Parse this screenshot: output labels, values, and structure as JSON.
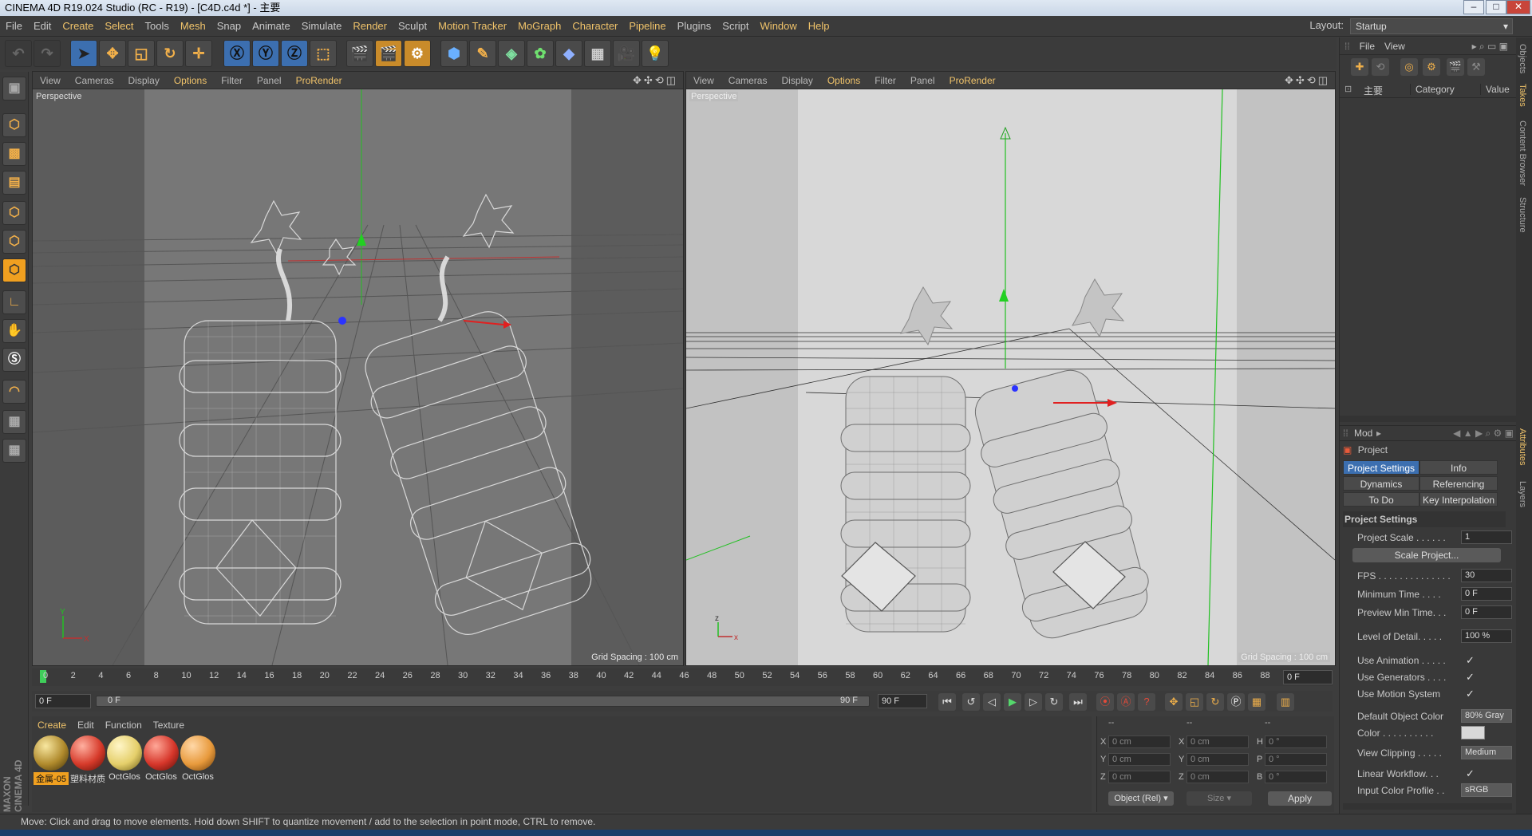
{
  "window": {
    "title": "CINEMA 4D R19.024 Studio (RC - R19) - [C4D.c4d *] - 主要"
  },
  "menu": [
    "File",
    "Edit",
    "Create",
    "Select",
    "Tools",
    "Mesh",
    "Snap",
    "Animate",
    "Simulate",
    "Render",
    "Sculpt",
    "Motion Tracker",
    "MoGraph",
    "Character",
    "Pipeline",
    "Plugins",
    "Script",
    "Window",
    "Help"
  ],
  "layout": {
    "label": "Layout:",
    "value": "Startup"
  },
  "viewport_left": {
    "menu": [
      "View",
      "Cameras",
      "Display",
      "Options",
      "Filter",
      "Panel",
      "ProRender"
    ],
    "label": "Perspective",
    "grid": "Grid Spacing : 100 cm"
  },
  "viewport_right": {
    "menu": [
      "View",
      "Cameras",
      "Display",
      "Options",
      "Filter",
      "Panel",
      "ProRender"
    ],
    "label": "Perspective",
    "grid": "Grid Spacing : 100 cm"
  },
  "timeline": {
    "ticks": [
      "0",
      "2",
      "4",
      "6",
      "8",
      "10",
      "12",
      "14",
      "16",
      "18",
      "20",
      "22",
      "24",
      "26",
      "28",
      "30",
      "32",
      "34",
      "36",
      "38",
      "40",
      "42",
      "44",
      "46",
      "48",
      "50",
      "52",
      "54",
      "56",
      "58",
      "60",
      "62",
      "64",
      "66",
      "68",
      "70",
      "72",
      "74",
      "76",
      "78",
      "80",
      "82",
      "84",
      "86",
      "88",
      "90"
    ],
    "frame_field": "0 F"
  },
  "transport": {
    "start": "0 F",
    "slider_left": "0 F",
    "slider_right": "90 F",
    "end": "90 F"
  },
  "materials": {
    "menu": [
      "Create",
      "Edit",
      "Function",
      "Texture"
    ],
    "items": [
      {
        "name": "金属-05",
        "color": "#b08a2c"
      },
      {
        "name": "塑料材质",
        "color": "#d63a2a"
      },
      {
        "name": "OctGlos",
        "color": "#e5cf6a"
      },
      {
        "name": "OctGlos",
        "color": "#d6362a"
      },
      {
        "name": "OctGlos",
        "color": "#e89a3c"
      }
    ]
  },
  "coords": {
    "headers": [
      "--",
      "--",
      "--"
    ],
    "rows": [
      {
        "a": "X",
        "av": "0 cm",
        "b": "X",
        "bv": "0 cm",
        "c": "H",
        "cv": "0 °"
      },
      {
        "a": "Y",
        "av": "0 cm",
        "b": "Y",
        "bv": "0 cm",
        "c": "P",
        "cv": "0 °"
      },
      {
        "a": "Z",
        "av": "0 cm",
        "b": "Z",
        "bv": "0 cm",
        "c": "B",
        "cv": "0 °"
      }
    ],
    "mode": "Object (Rel)",
    "size": "Size",
    "apply": "Apply"
  },
  "objects": {
    "menu": [
      "File",
      "View"
    ],
    "root": "主要",
    "cols": [
      "Category",
      "Value"
    ]
  },
  "attributes": {
    "mode": "Mod",
    "project": "Project",
    "tabs": [
      "Project Settings",
      "Info",
      "Dynamics",
      "Referencing",
      "To Do",
      "Key Interpolation"
    ],
    "section": "Project Settings",
    "fields": [
      {
        "label": "Project Scale . . . . . .",
        "value": "1"
      },
      {
        "label": "FPS . . . . . . . . . . . . . .",
        "value": "30"
      },
      {
        "label": "Minimum Time . . . .",
        "value": "0 F"
      },
      {
        "label": "Preview Min Time. . .",
        "value": "0 F"
      },
      {
        "label": "Level of Detail. . . . .",
        "value": "100 %"
      }
    ],
    "scale_button": "Scale Project...",
    "checks": [
      {
        "label": "Use Animation . . . . .",
        "value": "✓"
      },
      {
        "label": "Use Generators . . . .",
        "value": "✓"
      },
      {
        "label": "Use Motion System",
        "value": "✓"
      }
    ],
    "default_color": {
      "label": "Default Object Color",
      "value": "80% Gray"
    },
    "color": {
      "label": "Color . . . . . . . . . ."
    },
    "clipping": {
      "label": "View Clipping . . . . .",
      "value": "Medium"
    },
    "linear": {
      "label": "Linear Workflow. . .",
      "value": "✓"
    },
    "input_profile": {
      "label": "Input Color Profile . .",
      "value": "sRGB"
    }
  },
  "sidetabs": [
    "Objects",
    "Takes",
    "Content Browser",
    "Structure",
    "Attributes",
    "Layers"
  ],
  "status": "Move: Click and drag to move elements. Hold down SHIFT to quantize movement / add to the selection in point mode, CTRL to remove.",
  "brand": "MAXON CINEMA 4D"
}
